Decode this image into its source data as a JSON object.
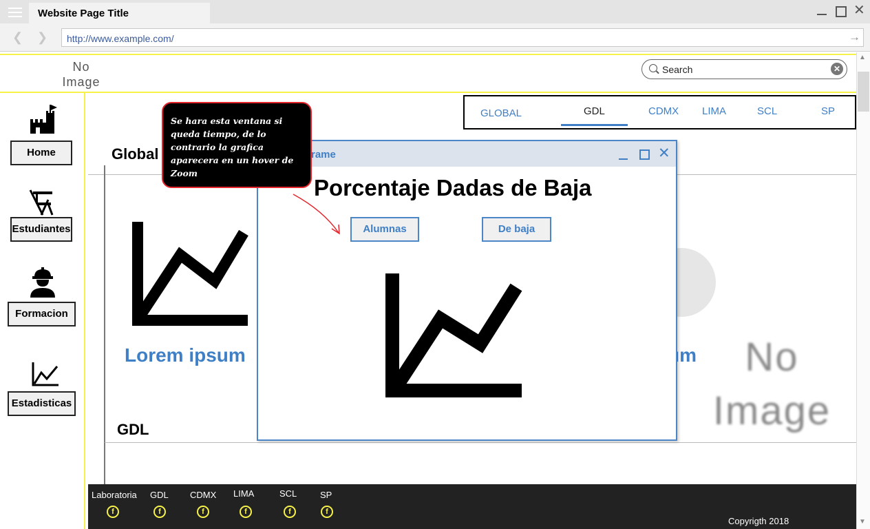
{
  "browser": {
    "tab_title": "Website Page Title",
    "url": "http://www.example.com/"
  },
  "header": {
    "logo_text_line1": "No",
    "logo_text_line2": "Image",
    "search_placeholder": "Search"
  },
  "sidebar": {
    "items": [
      {
        "label": "Home",
        "icon": "castle-icon"
      },
      {
        "label": "Estudiantes",
        "icon": "school-desk-icon"
      },
      {
        "label": "Formacion",
        "icon": "construction-worker-icon"
      },
      {
        "label": "Estadisticas",
        "icon": "line-chart-icon"
      }
    ]
  },
  "tabs": {
    "items": [
      "GLOBAL",
      "GDL",
      "CDMX",
      "LIMA",
      "SCL",
      "SP"
    ],
    "active": "GDL"
  },
  "main": {
    "section1_heading": "Global",
    "card1_title": "Lorem ipsum",
    "card2_title_partial": "um",
    "section2_heading": "GDL",
    "image_placeholder_line1": "No",
    "image_placeholder_line2": "Image"
  },
  "popup": {
    "title_partial": "rame",
    "heading": "Porcentaje Dadas de Baja",
    "button1": "Alumnas",
    "button2": "De baja"
  },
  "note": {
    "text": "Se hara esta ventana si queda tiempo, de lo contrario la grafica aparecera en un hover de Zoom",
    "border_color": "#e3252b"
  },
  "footer": {
    "links": [
      "Laboratoria",
      "GDL",
      "CDMX",
      "LIMA",
      "SCL",
      "SP"
    ],
    "icon": "facebook-icon",
    "copyright": "Copyrigth 2018"
  },
  "colors": {
    "accent": "#3f7fc6",
    "highlight": "#f6f24a",
    "footer_bg": "#222222"
  }
}
